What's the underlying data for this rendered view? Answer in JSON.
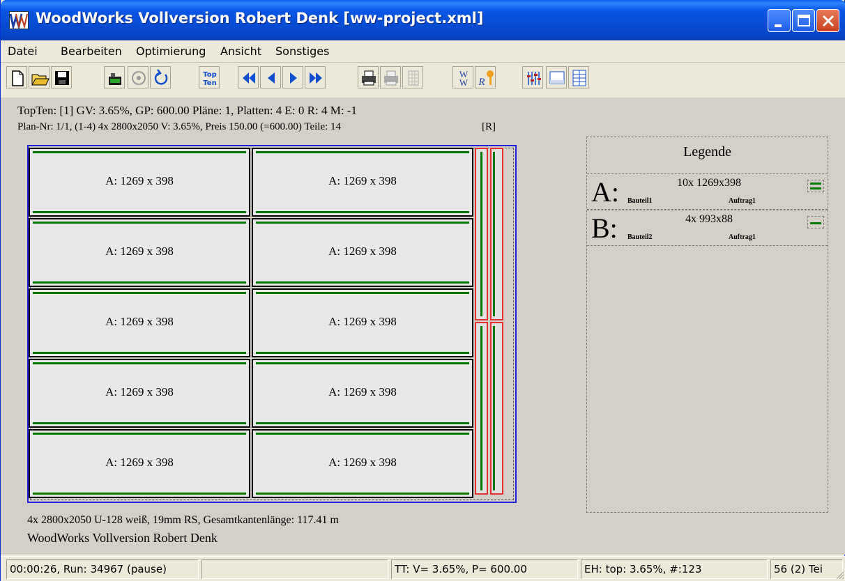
{
  "window": {
    "title": "WoodWorks Vollversion Robert Denk [ww-project.xml]"
  },
  "menu": {
    "items": [
      "Datei",
      "Bearbeiten",
      "Optimierung",
      "Ansicht",
      "Sonstiges"
    ]
  },
  "toolbar": {
    "buttons": [
      {
        "icon": "new-document-icon"
      },
      {
        "icon": "open-folder-icon"
      },
      {
        "icon": "save-disk-icon"
      },
      {
        "icon": "start-optimization-icon"
      },
      {
        "icon": "stop-icon"
      },
      {
        "icon": "reset-icon"
      },
      {
        "icon": "top-ten-icon",
        "label": "Top Ten"
      },
      {
        "icon": "first-icon"
      },
      {
        "icon": "previous-icon"
      },
      {
        "icon": "next-icon"
      },
      {
        "icon": "last-icon"
      },
      {
        "icon": "print-icon"
      },
      {
        "icon": "print-preview-icon"
      },
      {
        "icon": "grid-icon"
      },
      {
        "icon": "woodworks-logo-icon"
      },
      {
        "icon": "register-key-icon"
      },
      {
        "icon": "settings-sliders-icon"
      },
      {
        "icon": "window-view-icon"
      },
      {
        "icon": "layout-view-icon"
      }
    ]
  },
  "plan": {
    "info_line1": "TopTen: [1] GV:  3.65%, GP: 600.00 Pläne: 1, Platten: 4 E: 0 R: 4 M: -1",
    "info_line2": "Plan-Nr: 1/1, (1-4) 4x 2800x2050 V:  3.65%, Preis 150.00 (=600.00) Teile: 14",
    "info_tag": "[R]",
    "parts": [
      "A: 1269 x 398",
      "A: 1269 x 398",
      "A: 1269 x 398",
      "A: 1269 x 398",
      "A: 1269 x 398",
      "A: 1269 x 398",
      "A: 1269 x 398",
      "A: 1269 x 398",
      "A: 1269 x 398",
      "A: 1269 x 398"
    ],
    "footer_material": "4x 2800x2050 U-128 weiß, 19mm RS, Gesamtkantenlänge: 117.41 m",
    "footer_owner": "WoodWorks Vollversion Robert Denk"
  },
  "legend": {
    "title": "Legende",
    "entries": [
      {
        "letter": "A:",
        "dims": "10x 1269x398",
        "part": "Bauteil1",
        "order": "Auftrag1"
      },
      {
        "letter": "B:",
        "dims": "4x 993x88",
        "part": "Bauteil2",
        "order": "Auftrag1"
      }
    ]
  },
  "status": {
    "time_run": "00:00:26, Run: 34967 (pause)",
    "empty": "",
    "tt": "TT: V= 3.65%, P= 600.00",
    "eh": "EH: top: 3.65%,  #:123",
    "count": "56 (2) Tei"
  }
}
